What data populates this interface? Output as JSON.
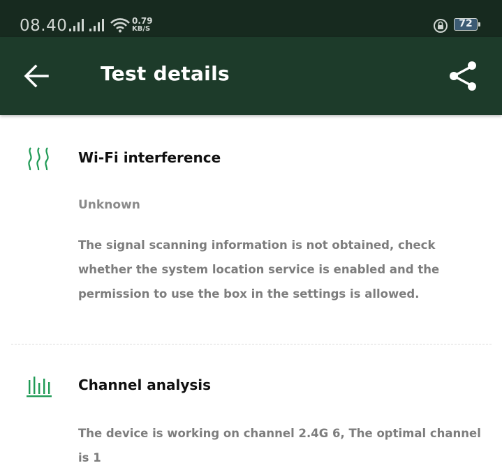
{
  "status_bar": {
    "time": "08.40",
    "net_speed_value": "0.79",
    "net_speed_unit": "KB/S",
    "battery": "72",
    "icons": [
      "signal-icon",
      "signal-icon",
      "wifi-icon",
      "rotation-lock-icon",
      "battery-icon"
    ]
  },
  "app_bar": {
    "title": "Test details",
    "back_icon": "back-arrow-icon",
    "share_icon": "share-icon",
    "background": "#1d3b2a"
  },
  "sections": [
    {
      "title": "Wi-Fi interference",
      "icon": "wifi-interference-icon",
      "status": "Unknown",
      "description": "The signal scanning information is not obtained, check whether the system location service is enabled and the permission to use the box in the settings is allowed."
    },
    {
      "title": "Channel analysis",
      "icon": "channel-analysis-icon",
      "description": "The device is working on channel 2.4G 6, The optimal channel is 1"
    }
  ],
  "colors": {
    "accent": "#1f9a55",
    "status_bar": "#172a1f"
  }
}
